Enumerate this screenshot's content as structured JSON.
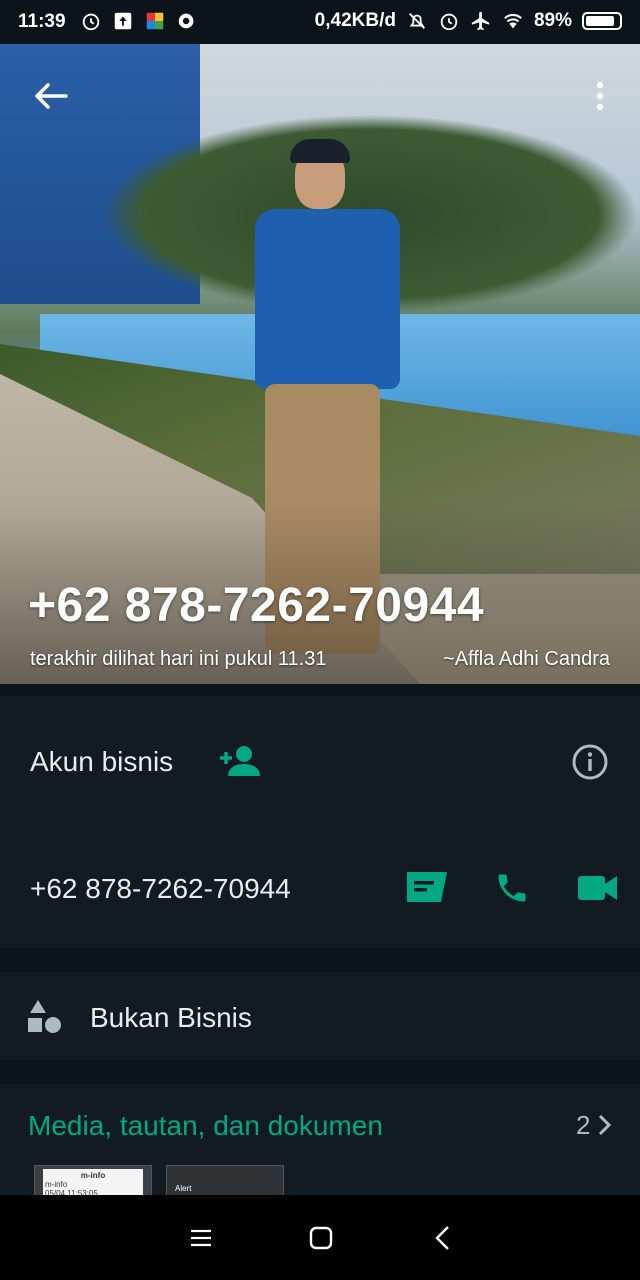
{
  "status_bar": {
    "time": "11:39",
    "network_speed": "0,42KB/d",
    "battery": "89%",
    "battery_level": 0.89,
    "left_icons": [
      "alarm-icon",
      "upload-icon",
      "app-icon",
      "camera-icon"
    ],
    "right_icons": [
      "mute-icon",
      "alarm-icon",
      "airplane-icon",
      "wifi-icon",
      "battery-icon"
    ]
  },
  "header": {
    "phone_title": "+62 878-7262-70944",
    "last_seen": "terakhir dilihat hari ini pukul 11.31",
    "push_name": "~Affla Adhi Candra"
  },
  "business_section": {
    "label": "Akun bisnis",
    "phone": "+62 878-7262-70944"
  },
  "category": {
    "label": "Bukan Bisnis"
  },
  "media": {
    "label": "Media, tautan, dan dokumen",
    "count": "2",
    "thumb1_title": "m-info",
    "thumb1_line1": "m-info",
    "thumb1_line2": "05/04 11:53:05",
    "thumb2_title": "Alert"
  },
  "colors": {
    "accent": "#00a884",
    "background": "#121b22",
    "divider": "#0b141a",
    "text": "#e9edef"
  }
}
